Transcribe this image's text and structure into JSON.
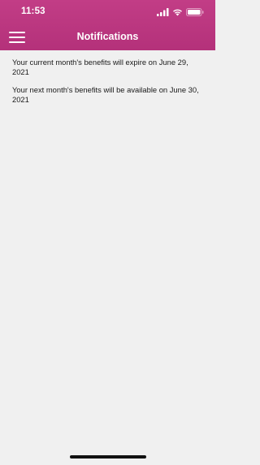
{
  "status_bar": {
    "time": "11:53",
    "icons": [
      "signal-icon",
      "wifi-icon",
      "battery-icon"
    ]
  },
  "header": {
    "title": "Notifications",
    "menu_icon": "hamburger-menu-icon",
    "background_color": "#b83580"
  },
  "notifications": [
    {
      "text": "Your current month's benefits will expire on June 29, 2021"
    },
    {
      "text": "Your next month's benefits will be available on June 30, 2021"
    }
  ],
  "colors": {
    "accent": "#b83580",
    "background": "#f0f0f0",
    "text": "#1a1a1a"
  }
}
